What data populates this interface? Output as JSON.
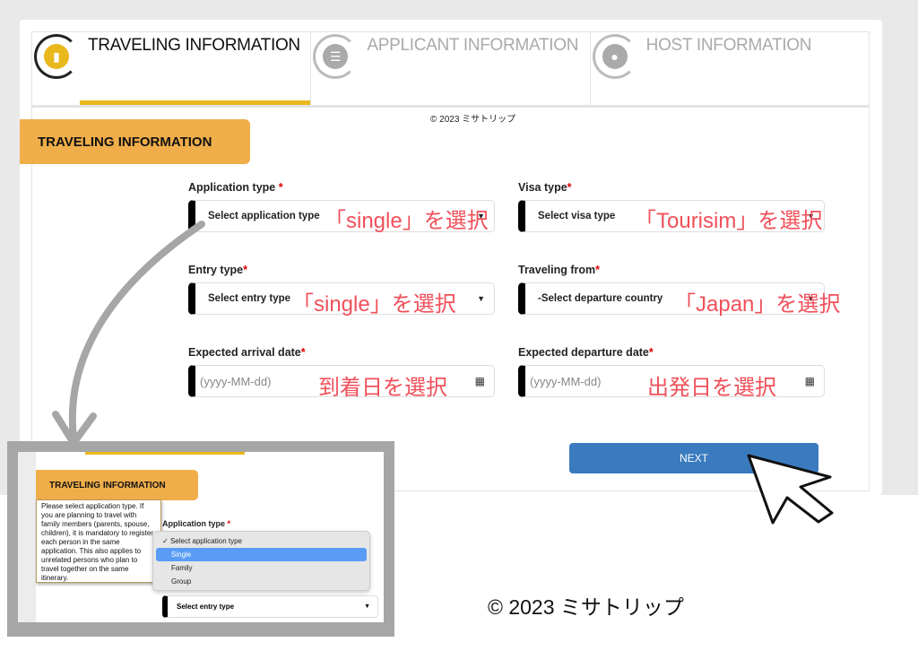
{
  "tabs": [
    {
      "label": "TRAVELING INFORMATION",
      "icon": "passport-icon",
      "active": true
    },
    {
      "label": "APPLICANT INFORMATION",
      "icon": "list-icon",
      "active": false
    },
    {
      "label": "HOST INFORMATION",
      "icon": "user-icon",
      "active": false
    }
  ],
  "copyright_small": "© 2023 ミサトリップ",
  "section_title": "TRAVELING INFORMATION",
  "fields": {
    "application_type": {
      "label": "Application type",
      "value": "Select application type",
      "annotation": "「single」を選択"
    },
    "visa_type": {
      "label": "Visa type",
      "value": "Select visa type",
      "annotation": "「Tourisim」を選択"
    },
    "entry_type": {
      "label": "Entry type",
      "value": "Select entry type",
      "annotation": "「single」を選択"
    },
    "traveling_from": {
      "label": "Traveling from",
      "value": "-Select departure country",
      "annotation": "「Japan」を選択"
    },
    "arrival_date": {
      "label": "Expected arrival date",
      "placeholder": "(yyyy-MM-dd)",
      "annotation": "到着日を選択"
    },
    "departure_date": {
      "label": "Expected departure date",
      "placeholder": "(yyyy-MM-dd)",
      "annotation": "出発日を選択"
    }
  },
  "required_mark": "*",
  "next_label": "NEXT",
  "inset": {
    "section_title": "TRAVELING INFORMATION",
    "tooltip": "Please select application type. If you are planning to travel with family members (parents, spouse, children), it is mandatory to register each person in the same application. This also applies to unrelated persons who plan to travel together on the same itinerary.",
    "label": "Application type",
    "options": [
      "Select application type",
      "Single",
      "Family",
      "Group"
    ],
    "checked_option": "Select application type",
    "highlighted_option": "Single",
    "entry_value": "Select entry type"
  },
  "copyright_large": "© 2023 ミサトリップ",
  "colors": {
    "accent": "#e9b81c",
    "section": "#f0ae4a",
    "annotation": "#f0505a",
    "next": "#3a7bbf",
    "highlight": "#5a9cf5"
  }
}
